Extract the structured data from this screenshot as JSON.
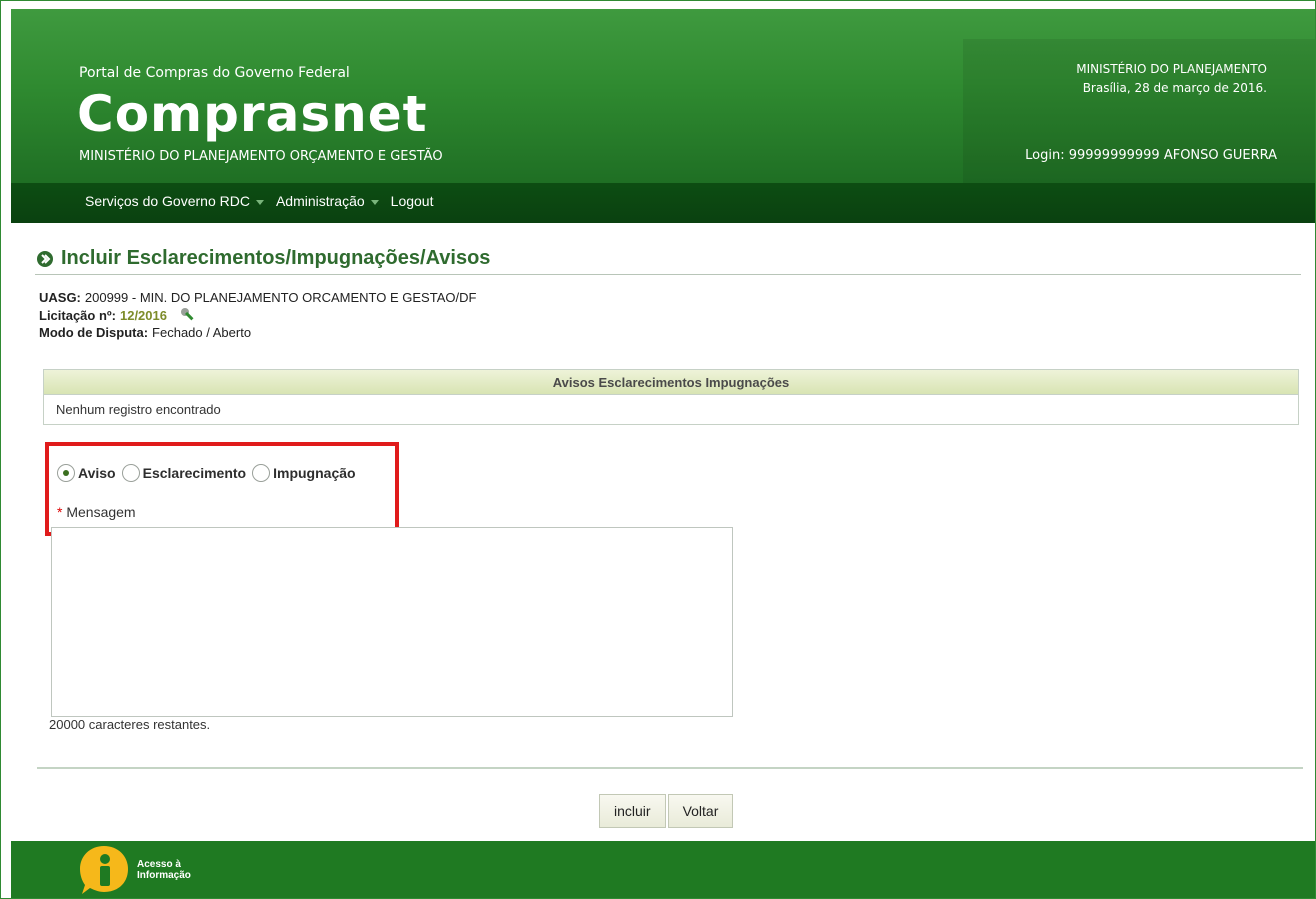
{
  "header": {
    "portal_line": "Portal de Compras do Governo Federal",
    "brand": "Comprasnet",
    "ministry": "MINISTÉRIO DO PLANEJAMENTO ORÇAMENTO E GESTÃO",
    "top_right_line1": "MINISTÉRIO DO PLANEJAMENTO",
    "top_right_line2": "Brasília, 28 de março de 2016.",
    "login": "Login: 99999999999 AFONSO GUERRA"
  },
  "nav": {
    "items": [
      {
        "label": "Serviços do Governo RDC"
      },
      {
        "label": "Administração"
      },
      {
        "label": "Logout"
      }
    ]
  },
  "page": {
    "title": "Incluir Esclarecimentos/Impugnações/Avisos",
    "uasg_label": "UASG:",
    "uasg_value": "200999 - MIN. DO PLANEJAMENTO ORCAMENTO E GESTAO/DF",
    "licitacao_label": "Licitação nº:",
    "licitacao_value": "12/2016",
    "modo_label": "Modo de Disputa:",
    "modo_value": "Fechado / Aberto"
  },
  "table": {
    "header": "Avisos Esclarecimentos Impugnações",
    "empty": "Nenhum registro encontrado"
  },
  "form": {
    "options": [
      {
        "label": "Aviso",
        "selected": true
      },
      {
        "label": "Esclarecimento",
        "selected": false
      },
      {
        "label": "Impugnação",
        "selected": false
      }
    ],
    "required_mark": "*",
    "message_label": "Mensagem",
    "message_value": "",
    "chars_remaining": "20000 caracteres restantes."
  },
  "buttons": {
    "include": "incluir",
    "back": "Voltar"
  },
  "footer": {
    "logo_text_line1": "Acesso à",
    "logo_text_line2": "Informação"
  },
  "colors": {
    "header_green": "#2f8a30",
    "nav_green": "#0d4d12",
    "title_green": "#2f6b2f",
    "highlight_red": "#e01b1b",
    "footer_green": "#1f7a22"
  }
}
